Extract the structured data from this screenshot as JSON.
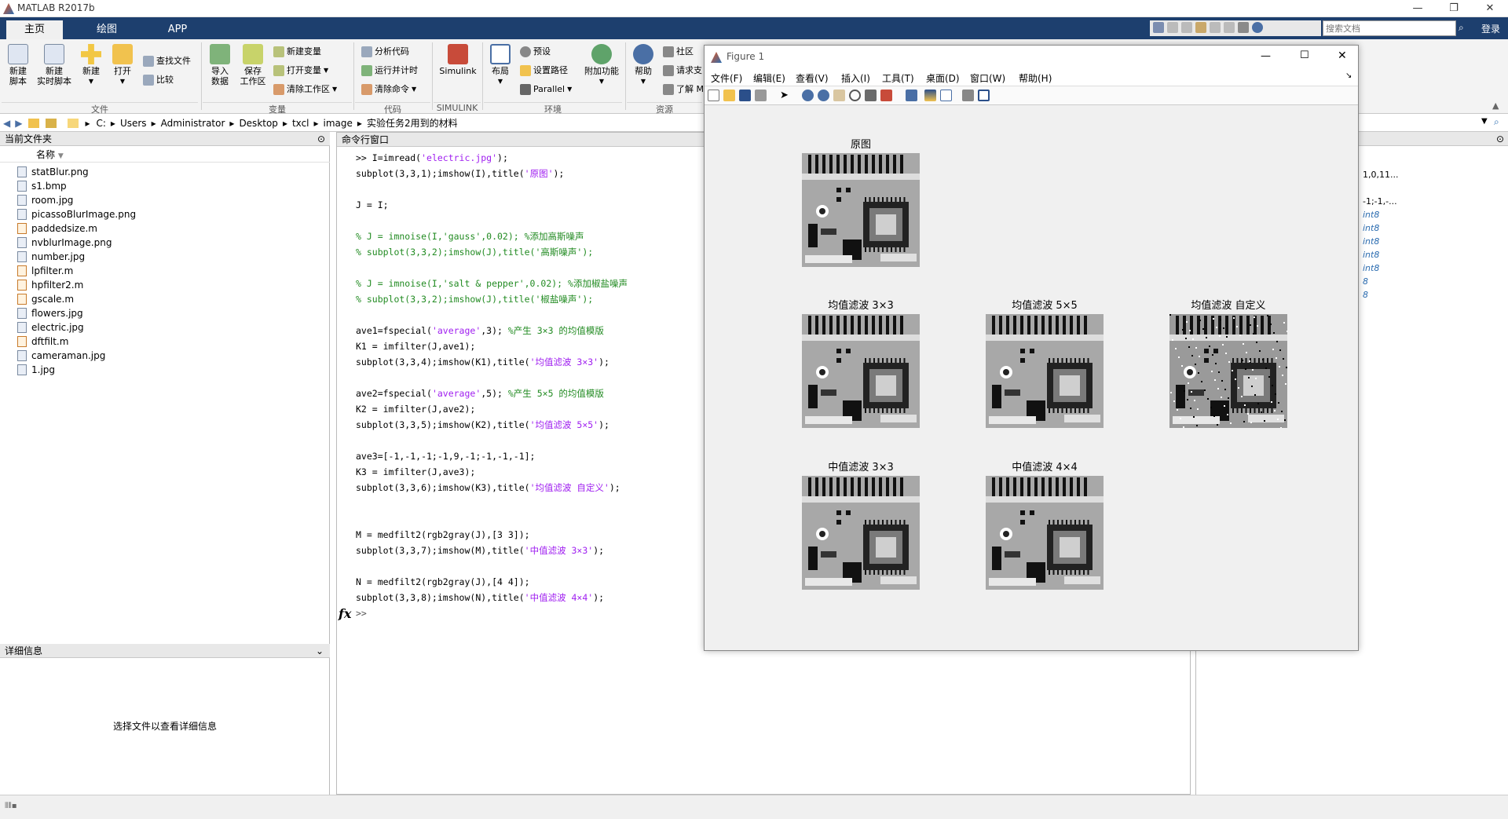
{
  "app": {
    "title": "MATLAB R2017b"
  },
  "tabs": [
    {
      "label": "主页"
    },
    {
      "label": "绘图"
    },
    {
      "label": "APP"
    }
  ],
  "toolbar": {
    "new_script": "新建\n脚本",
    "new_live": "新建\n实时脚本",
    "new": "新建",
    "open": "打开",
    "find_files": "查找文件",
    "compare": "比较",
    "import": "导入\n数据",
    "save_ws": "保存\n工作区",
    "new_var": "新建变量",
    "open_var": "打开变量",
    "clear_ws": "清除工作区",
    "analyze": "分析代码",
    "run_time": "运行并计时",
    "clear_cmd": "清除命令",
    "simulink": "Simulink",
    "layout": "布局",
    "preferences": "预设",
    "set_path": "设置路径",
    "parallel": "Parallel",
    "addons": "附加功能",
    "help": "帮助",
    "community": "社区",
    "request": "请求支",
    "learn": "了解 M",
    "groups": {
      "file": "文件",
      "variable": "变量",
      "code": "代码",
      "simulink": "SIMULINK",
      "env": "环境",
      "resources": "资源"
    }
  },
  "search": {
    "placeholder": "搜索文档",
    "login": "登录"
  },
  "address": {
    "crumbs": [
      "C:",
      "Users",
      "Administrator",
      "Desktop",
      "txcl",
      "image",
      "实验任务2用到的材料"
    ]
  },
  "file_panel": {
    "title": "当前文件夹",
    "column": "名称",
    "files": [
      {
        "name": "statBlur.png",
        "type": "img"
      },
      {
        "name": "s1.bmp",
        "type": "img"
      },
      {
        "name": "room.jpg",
        "type": "img"
      },
      {
        "name": "picassoBlurImage.png",
        "type": "img"
      },
      {
        "name": "paddedsize.m",
        "type": "m"
      },
      {
        "name": "nvblurImage.png",
        "type": "img"
      },
      {
        "name": "number.jpg",
        "type": "img"
      },
      {
        "name": "lpfilter.m",
        "type": "m"
      },
      {
        "name": "hpfilter2.m",
        "type": "m"
      },
      {
        "name": "gscale.m",
        "type": "m"
      },
      {
        "name": "flowers.jpg",
        "type": "img"
      },
      {
        "name": "electric.jpg",
        "type": "img"
      },
      {
        "name": "dftfilt.m",
        "type": "m"
      },
      {
        "name": "cameraman.jpg",
        "type": "img"
      },
      {
        "name": "1.jpg",
        "type": "img"
      }
    ]
  },
  "detail_panel": {
    "title": "详细信息",
    "message": "选择文件以查看详细信息"
  },
  "command_window": {
    "title": "命令行窗口",
    "prompt": ">>",
    "lines": [
      [
        {
          "t": ">> I=imread(",
          "c": ""
        },
        {
          "t": "'electric.jpg'",
          "c": "str"
        },
        {
          "t": ");",
          "c": ""
        }
      ],
      [
        {
          "t": "subplot(3,3,1);imshow(I),title(",
          "c": ""
        },
        {
          "t": "'原图'",
          "c": "str"
        },
        {
          "t": ");",
          "c": ""
        }
      ],
      [],
      [
        {
          "t": "J = I;",
          "c": ""
        }
      ],
      [],
      [
        {
          "t": "% J = imnoise(I,'gauss',0.02); %添加高斯噪声",
          "c": "cmt"
        }
      ],
      [
        {
          "t": "% subplot(3,3,2);imshow(J),title('高斯噪声');",
          "c": "cmt"
        }
      ],
      [],
      [
        {
          "t": "% J = imnoise(I,'salt & pepper',0.02); %添加椒盐噪声",
          "c": "cmt"
        }
      ],
      [
        {
          "t": "% subplot(3,3,2);imshow(J),title('椒盐噪声');",
          "c": "cmt"
        }
      ],
      [],
      [
        {
          "t": "ave1=fspecial(",
          "c": ""
        },
        {
          "t": "'average'",
          "c": "str"
        },
        {
          "t": ",3); ",
          "c": ""
        },
        {
          "t": "%产生 3×3 的均值模版",
          "c": "cmt"
        }
      ],
      [
        {
          "t": "K1 = imfilter(J,ave1);",
          "c": ""
        }
      ],
      [
        {
          "t": "subplot(3,3,4);imshow(K1),title(",
          "c": ""
        },
        {
          "t": "'均值滤波 3×3'",
          "c": "str"
        },
        {
          "t": ");",
          "c": ""
        }
      ],
      [],
      [
        {
          "t": "ave2=fspecial(",
          "c": ""
        },
        {
          "t": "'average'",
          "c": "str"
        },
        {
          "t": ",5); ",
          "c": ""
        },
        {
          "t": "%产生 5×5 的均值模版",
          "c": "cmt"
        }
      ],
      [
        {
          "t": "K2 = imfilter(J,ave2);",
          "c": ""
        }
      ],
      [
        {
          "t": "subplot(3,3,5);imshow(K2),title(",
          "c": ""
        },
        {
          "t": "'均值滤波 5×5'",
          "c": "str"
        },
        {
          "t": ");",
          "c": ""
        }
      ],
      [],
      [
        {
          "t": "ave3=[-1,-1,-1;-1,9,-1;-1,-1,-1];",
          "c": ""
        }
      ],
      [
        {
          "t": "K3 = imfilter(J,ave3);",
          "c": ""
        }
      ],
      [
        {
          "t": "subplot(3,3,6);imshow(K3),title(",
          "c": ""
        },
        {
          "t": "'均值滤波 自定义'",
          "c": "str"
        },
        {
          "t": ");",
          "c": ""
        }
      ],
      [],
      [],
      [
        {
          "t": "M = medfilt2(rgb2gray(J),[3 3]);",
          "c": ""
        }
      ],
      [
        {
          "t": "subplot(3,3,7);imshow(M),title(",
          "c": ""
        },
        {
          "t": "'中值滤波 3×3'",
          "c": "str"
        },
        {
          "t": ");",
          "c": ""
        }
      ],
      [],
      [
        {
          "t": "N = medfilt2(rgb2gray(J),[4 4]);",
          "c": ""
        }
      ],
      [
        {
          "t": "subplot(3,3,8);imshow(N),title(",
          "c": ""
        },
        {
          "t": "'中值滤波 4×4'",
          "c": "str"
        },
        {
          "t": ");",
          "c": ""
        }
      ]
    ]
  },
  "workspace_partial": [
    "1,0,11...",
    "-1;-1,-...",
    "int8",
    "int8",
    "int8",
    "int8",
    "int8",
    "8",
    "8"
  ],
  "figure": {
    "title": "Figure 1",
    "menus": [
      "文件(F)",
      "编辑(E)",
      "查看(V)",
      "插入(I)",
      "工具(T)",
      "桌面(D)",
      "窗口(W)",
      "帮助(H)"
    ],
    "subplots": [
      {
        "title": "原图",
        "style": "normal"
      },
      {
        "title": "均值滤波 3×3",
        "style": "normal"
      },
      {
        "title": "均值滤波 5×5",
        "style": "normal"
      },
      {
        "title": "均值滤波 自定义",
        "style": "sharp"
      },
      {
        "title": "中值滤波 3×3",
        "style": "normal"
      },
      {
        "title": "中值滤波 4×4",
        "style": "normal"
      }
    ]
  },
  "colors": {
    "tabbar": "#1d3f6e",
    "string": "#a020f0",
    "comment": "#228b22"
  }
}
